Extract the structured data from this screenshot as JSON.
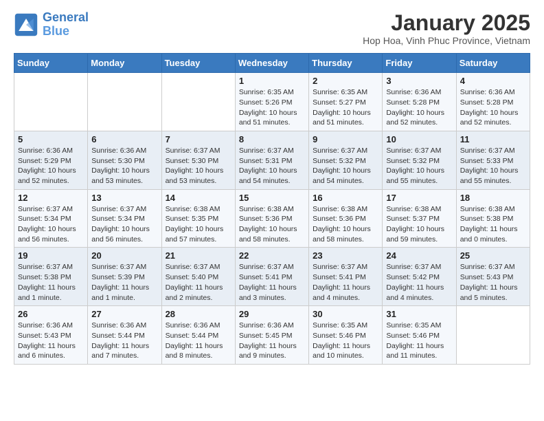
{
  "logo": {
    "name1": "General",
    "name2": "Blue"
  },
  "title": "January 2025",
  "subtitle": "Hop Hoa, Vinh Phuc Province, Vietnam",
  "days_header": [
    "Sunday",
    "Monday",
    "Tuesday",
    "Wednesday",
    "Thursday",
    "Friday",
    "Saturday"
  ],
  "weeks": [
    [
      {
        "day": "",
        "content": ""
      },
      {
        "day": "",
        "content": ""
      },
      {
        "day": "",
        "content": ""
      },
      {
        "day": "1",
        "content": "Sunrise: 6:35 AM\nSunset: 5:26 PM\nDaylight: 10 hours\nand 51 minutes."
      },
      {
        "day": "2",
        "content": "Sunrise: 6:35 AM\nSunset: 5:27 PM\nDaylight: 10 hours\nand 51 minutes."
      },
      {
        "day": "3",
        "content": "Sunrise: 6:36 AM\nSunset: 5:28 PM\nDaylight: 10 hours\nand 52 minutes."
      },
      {
        "day": "4",
        "content": "Sunrise: 6:36 AM\nSunset: 5:28 PM\nDaylight: 10 hours\nand 52 minutes."
      }
    ],
    [
      {
        "day": "5",
        "content": "Sunrise: 6:36 AM\nSunset: 5:29 PM\nDaylight: 10 hours\nand 52 minutes."
      },
      {
        "day": "6",
        "content": "Sunrise: 6:36 AM\nSunset: 5:30 PM\nDaylight: 10 hours\nand 53 minutes."
      },
      {
        "day": "7",
        "content": "Sunrise: 6:37 AM\nSunset: 5:30 PM\nDaylight: 10 hours\nand 53 minutes."
      },
      {
        "day": "8",
        "content": "Sunrise: 6:37 AM\nSunset: 5:31 PM\nDaylight: 10 hours\nand 54 minutes."
      },
      {
        "day": "9",
        "content": "Sunrise: 6:37 AM\nSunset: 5:32 PM\nDaylight: 10 hours\nand 54 minutes."
      },
      {
        "day": "10",
        "content": "Sunrise: 6:37 AM\nSunset: 5:32 PM\nDaylight: 10 hours\nand 55 minutes."
      },
      {
        "day": "11",
        "content": "Sunrise: 6:37 AM\nSunset: 5:33 PM\nDaylight: 10 hours\nand 55 minutes."
      }
    ],
    [
      {
        "day": "12",
        "content": "Sunrise: 6:37 AM\nSunset: 5:34 PM\nDaylight: 10 hours\nand 56 minutes."
      },
      {
        "day": "13",
        "content": "Sunrise: 6:37 AM\nSunset: 5:34 PM\nDaylight: 10 hours\nand 56 minutes."
      },
      {
        "day": "14",
        "content": "Sunrise: 6:38 AM\nSunset: 5:35 PM\nDaylight: 10 hours\nand 57 minutes."
      },
      {
        "day": "15",
        "content": "Sunrise: 6:38 AM\nSunset: 5:36 PM\nDaylight: 10 hours\nand 58 minutes."
      },
      {
        "day": "16",
        "content": "Sunrise: 6:38 AM\nSunset: 5:36 PM\nDaylight: 10 hours\nand 58 minutes."
      },
      {
        "day": "17",
        "content": "Sunrise: 6:38 AM\nSunset: 5:37 PM\nDaylight: 10 hours\nand 59 minutes."
      },
      {
        "day": "18",
        "content": "Sunrise: 6:38 AM\nSunset: 5:38 PM\nDaylight: 11 hours\nand 0 minutes."
      }
    ],
    [
      {
        "day": "19",
        "content": "Sunrise: 6:37 AM\nSunset: 5:38 PM\nDaylight: 11 hours\nand 1 minute."
      },
      {
        "day": "20",
        "content": "Sunrise: 6:37 AM\nSunset: 5:39 PM\nDaylight: 11 hours\nand 1 minute."
      },
      {
        "day": "21",
        "content": "Sunrise: 6:37 AM\nSunset: 5:40 PM\nDaylight: 11 hours\nand 2 minutes."
      },
      {
        "day": "22",
        "content": "Sunrise: 6:37 AM\nSunset: 5:41 PM\nDaylight: 11 hours\nand 3 minutes."
      },
      {
        "day": "23",
        "content": "Sunrise: 6:37 AM\nSunset: 5:41 PM\nDaylight: 11 hours\nand 4 minutes."
      },
      {
        "day": "24",
        "content": "Sunrise: 6:37 AM\nSunset: 5:42 PM\nDaylight: 11 hours\nand 4 minutes."
      },
      {
        "day": "25",
        "content": "Sunrise: 6:37 AM\nSunset: 5:43 PM\nDaylight: 11 hours\nand 5 minutes."
      }
    ],
    [
      {
        "day": "26",
        "content": "Sunrise: 6:36 AM\nSunset: 5:43 PM\nDaylight: 11 hours\nand 6 minutes."
      },
      {
        "day": "27",
        "content": "Sunrise: 6:36 AM\nSunset: 5:44 PM\nDaylight: 11 hours\nand 7 minutes."
      },
      {
        "day": "28",
        "content": "Sunrise: 6:36 AM\nSunset: 5:44 PM\nDaylight: 11 hours\nand 8 minutes."
      },
      {
        "day": "29",
        "content": "Sunrise: 6:36 AM\nSunset: 5:45 PM\nDaylight: 11 hours\nand 9 minutes."
      },
      {
        "day": "30",
        "content": "Sunrise: 6:35 AM\nSunset: 5:46 PM\nDaylight: 11 hours\nand 10 minutes."
      },
      {
        "day": "31",
        "content": "Sunrise: 6:35 AM\nSunset: 5:46 PM\nDaylight: 11 hours\nand 11 minutes."
      },
      {
        "day": "",
        "content": ""
      }
    ]
  ]
}
